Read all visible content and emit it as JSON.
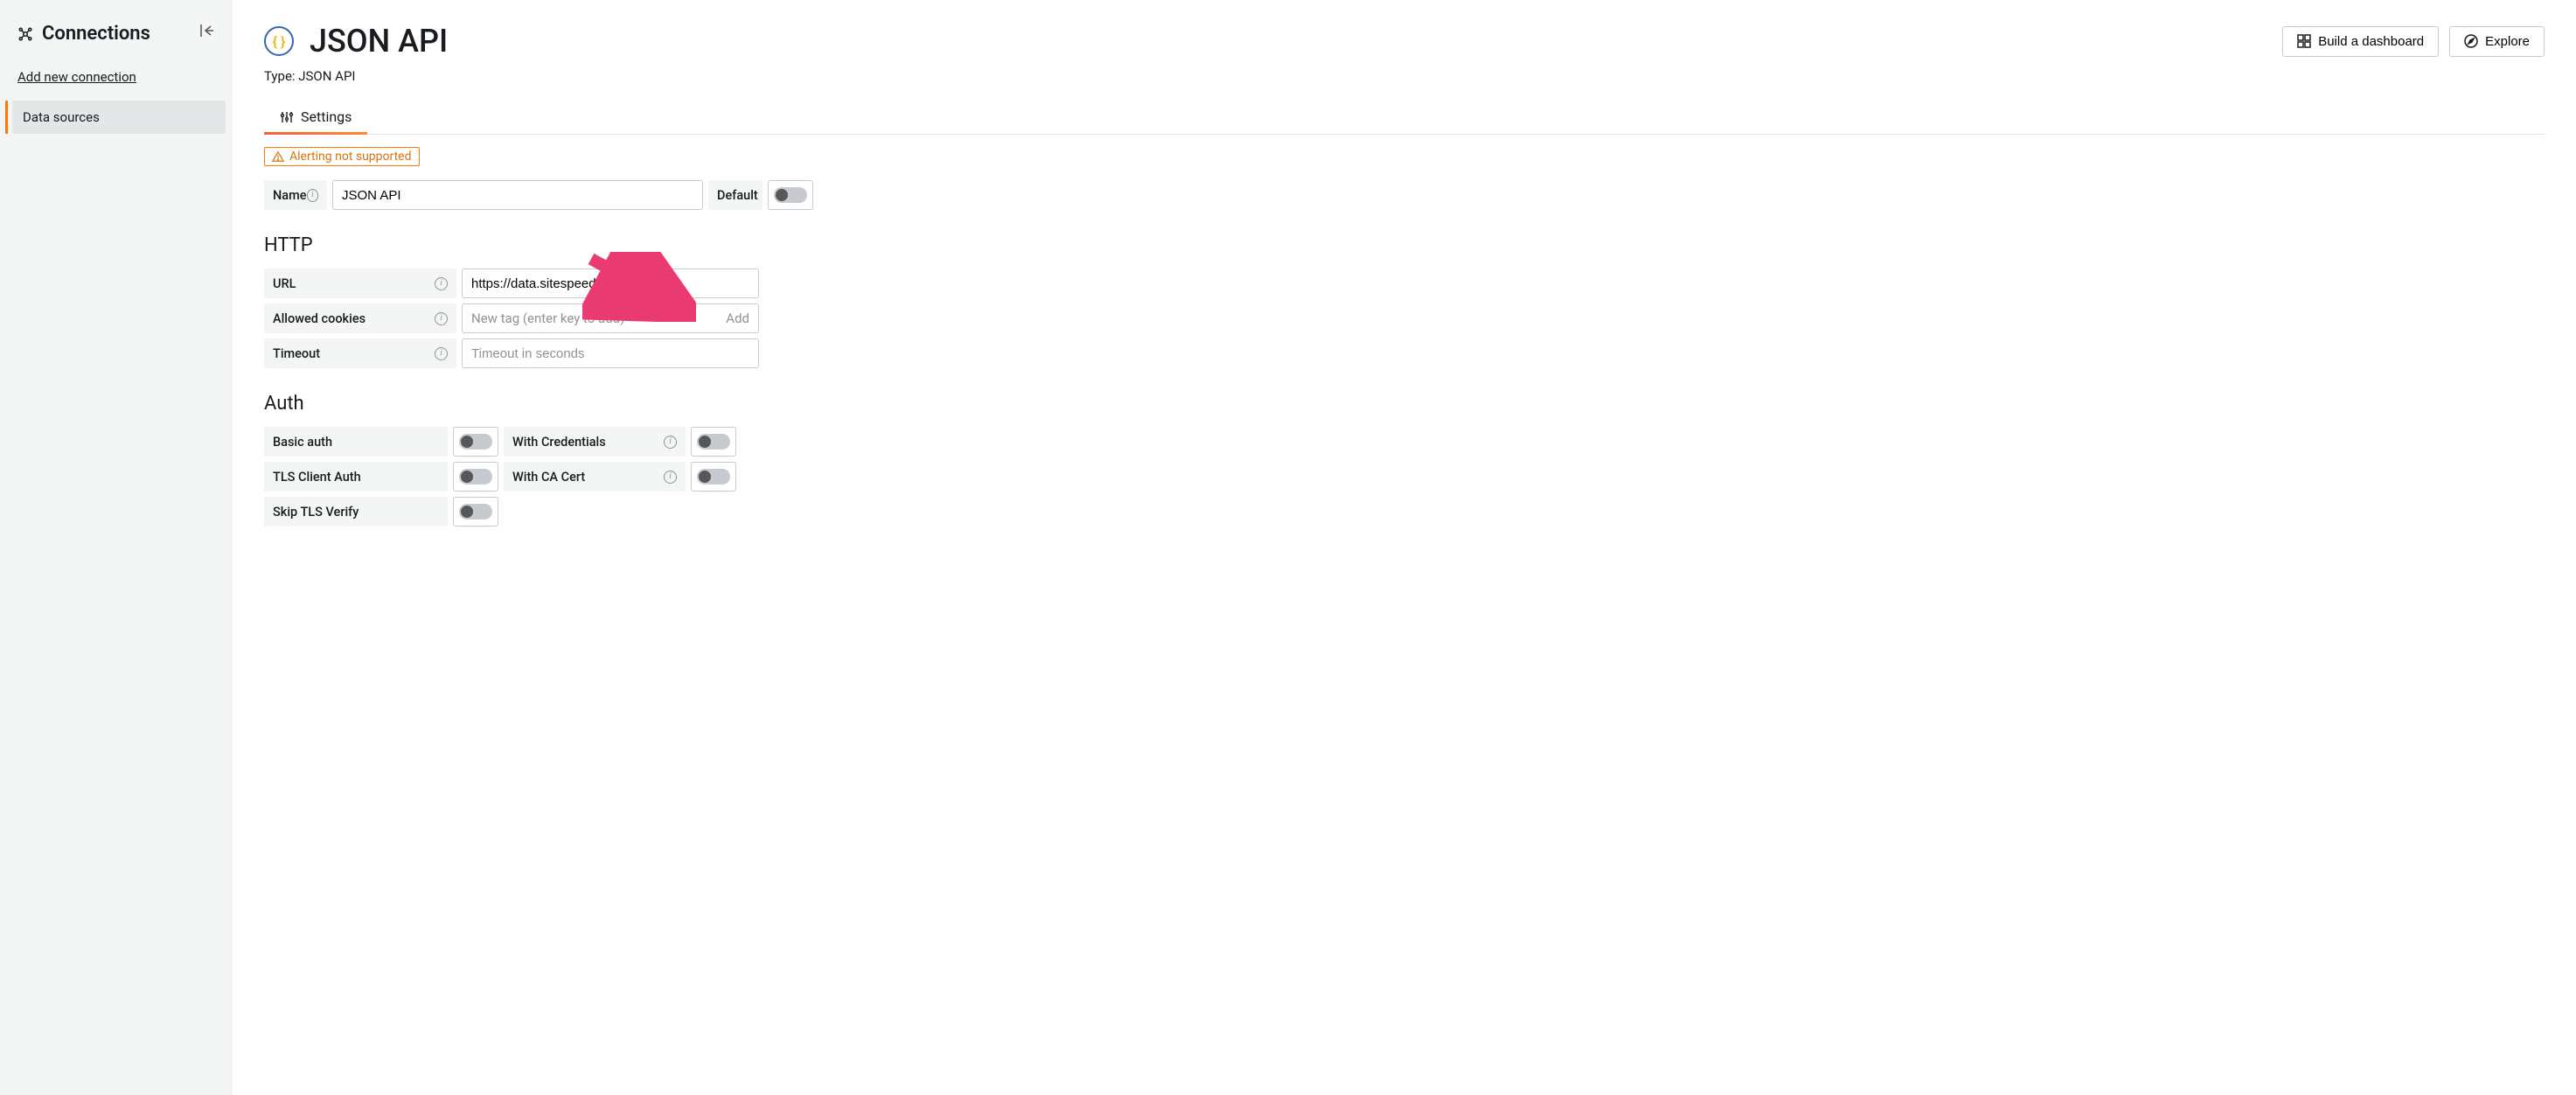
{
  "sidebar": {
    "title": "Connections",
    "add_link": "Add new connection",
    "items": [
      {
        "label": "Data sources",
        "active": true
      }
    ]
  },
  "header": {
    "title": "JSON API",
    "type_line": "Type: JSON API",
    "build_dashboard": "Build a dashboard",
    "explore": "Explore"
  },
  "tabs": {
    "settings": "Settings"
  },
  "alert_badge": "Alerting not supported",
  "form": {
    "name_label": "Name",
    "name_value": "JSON API",
    "default_label": "Default",
    "http_heading": "HTTP",
    "url_label": "URL",
    "url_value": "https://data.sitespeed.io/",
    "cookies_label": "Allowed cookies",
    "cookies_placeholder": "New tag (enter key to add)",
    "cookies_add": "Add",
    "timeout_label": "Timeout",
    "timeout_placeholder": "Timeout in seconds",
    "auth_heading": "Auth",
    "basic_auth_label": "Basic auth",
    "with_credentials_label": "With Credentials",
    "tls_client_label": "TLS Client Auth",
    "with_ca_label": "With CA Cert",
    "skip_tls_label": "Skip TLS Verify"
  }
}
